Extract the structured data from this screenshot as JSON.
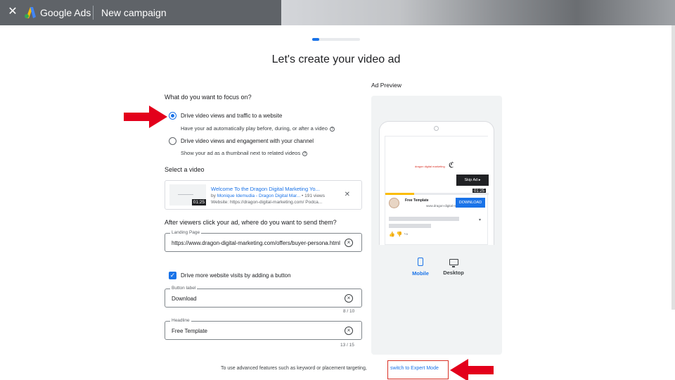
{
  "header": {
    "close_icon": "close-icon",
    "brand_google": "Google",
    "brand_ads": "Ads",
    "campaign_title": "New campaign"
  },
  "progress": {
    "value_percent": 15
  },
  "page_title": "Let's create your video ad",
  "focus": {
    "question": "What do you want to focus on?",
    "options": [
      {
        "label": "Drive video views and traffic to a website",
        "description": "Have your ad automatically play before, during, or after a video",
        "selected": true
      },
      {
        "label": "Drive video views and engagement with your channel",
        "description": "Show your ad as a thumbnail next to related videos",
        "selected": false
      }
    ]
  },
  "video": {
    "section_label": "Select a video",
    "title": "Welcome To the Dragon Digital Marketing Yo...",
    "by_prefix": "by",
    "channel": "Monique Idemudia - Dragon Digital Mar...",
    "views": "• 191 views",
    "website": "Website: https://dragon-digital-marketing.com/ Podca...",
    "duration": "01:25"
  },
  "destination": {
    "question": "After viewers click your ad, where do you want to send them?",
    "landing_label": "Landing Page",
    "landing_value": "https://www.dragon-digital-marketing.com/offers/buyer-persona.html"
  },
  "button_option": {
    "checkbox_label": "Drive more website visits by adding a button",
    "checked": true,
    "button_label_caption": "Button label",
    "button_label_value": "Download",
    "button_label_count": "8 / 10",
    "headline_caption": "Headline",
    "headline_value": "Free Template",
    "headline_count": "13 / 15"
  },
  "preview": {
    "title": "Ad Preview",
    "video_logo_text": "dragon digital marketing",
    "skip_label": "Skip Ad ▸",
    "duration": "01:25",
    "played_fraction": 0.28,
    "ad_name": "Free Template",
    "ad_url": "www.dragon-digital-mark...",
    "cta": "DOWNLOAD",
    "devices": [
      {
        "label": "Mobile",
        "icon": "smartphone-icon",
        "selected": true
      },
      {
        "label": "Desktop",
        "icon": "desktop-icon",
        "selected": false
      }
    ]
  },
  "footer": {
    "text": "To use advanced features such as keyword or placement targeting,",
    "link": "switch to Expert Mode"
  },
  "colors": {
    "accent": "#1a73e8",
    "annotation_red": "#d93025",
    "topbar": "#5f6368"
  }
}
